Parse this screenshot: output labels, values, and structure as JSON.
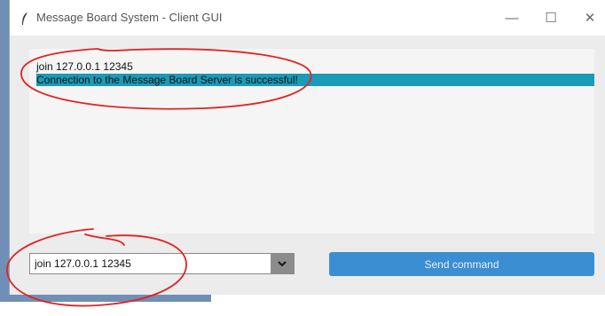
{
  "window": {
    "title": "Message Board System - Client GUI",
    "controls": {
      "minimize": "—",
      "maximize": "☐",
      "close": "✕"
    }
  },
  "console": {
    "lines": [
      {
        "text": "join 127.0.0.1 12345",
        "highlighted": false
      },
      {
        "text": "Connection to the Message Board Server is successful!",
        "highlighted": true
      }
    ],
    "highlight_color": "#1a9bb7"
  },
  "command": {
    "value": "join 127.0.0.1 12345",
    "dropdown_icon": "chevron-down-icon"
  },
  "send_button": {
    "label": "Send command",
    "color": "#3b8ed1"
  },
  "annotation": {
    "color": "#e02424",
    "shape": "freehand-ellipse"
  }
}
